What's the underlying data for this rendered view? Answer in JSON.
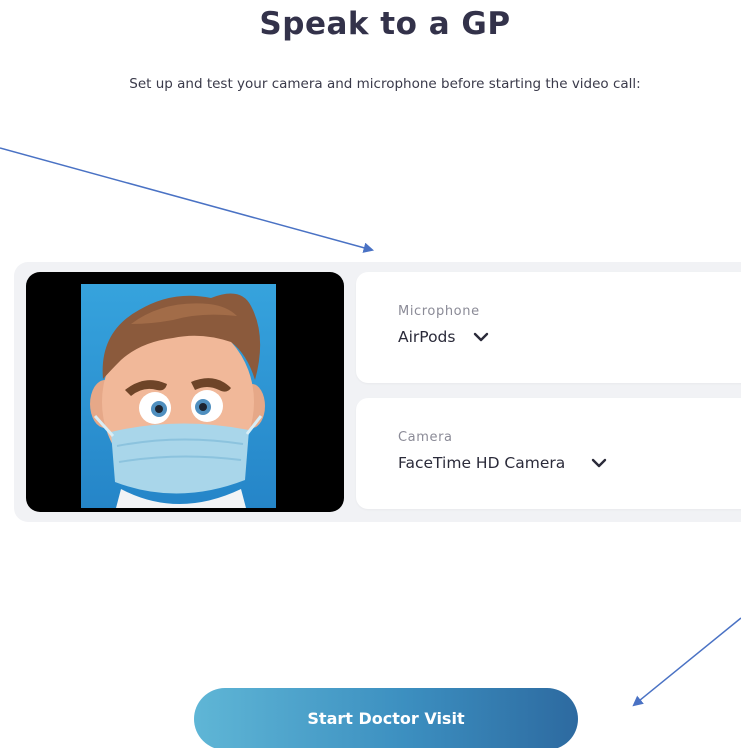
{
  "header": {
    "title": "Speak to a GP",
    "subtitle": "Set up and test your camera and microphone before starting the video call:"
  },
  "preview": {
    "icon": "avatar-icon"
  },
  "microphone": {
    "label": "Microphone",
    "selected": "AirPods",
    "icon": "chevron-down-icon"
  },
  "camera": {
    "label": "Camera",
    "selected": "FaceTime HD Camera",
    "icon": "chevron-down-icon"
  },
  "actions": {
    "start_label": "Start Doctor Visit"
  },
  "colors": {
    "title": "#33324a",
    "panel": "#f1f2f5",
    "button_start": "#5fb6d6",
    "button_end": "#2d6aa0",
    "annotation_arrow": "#4a72c4"
  }
}
